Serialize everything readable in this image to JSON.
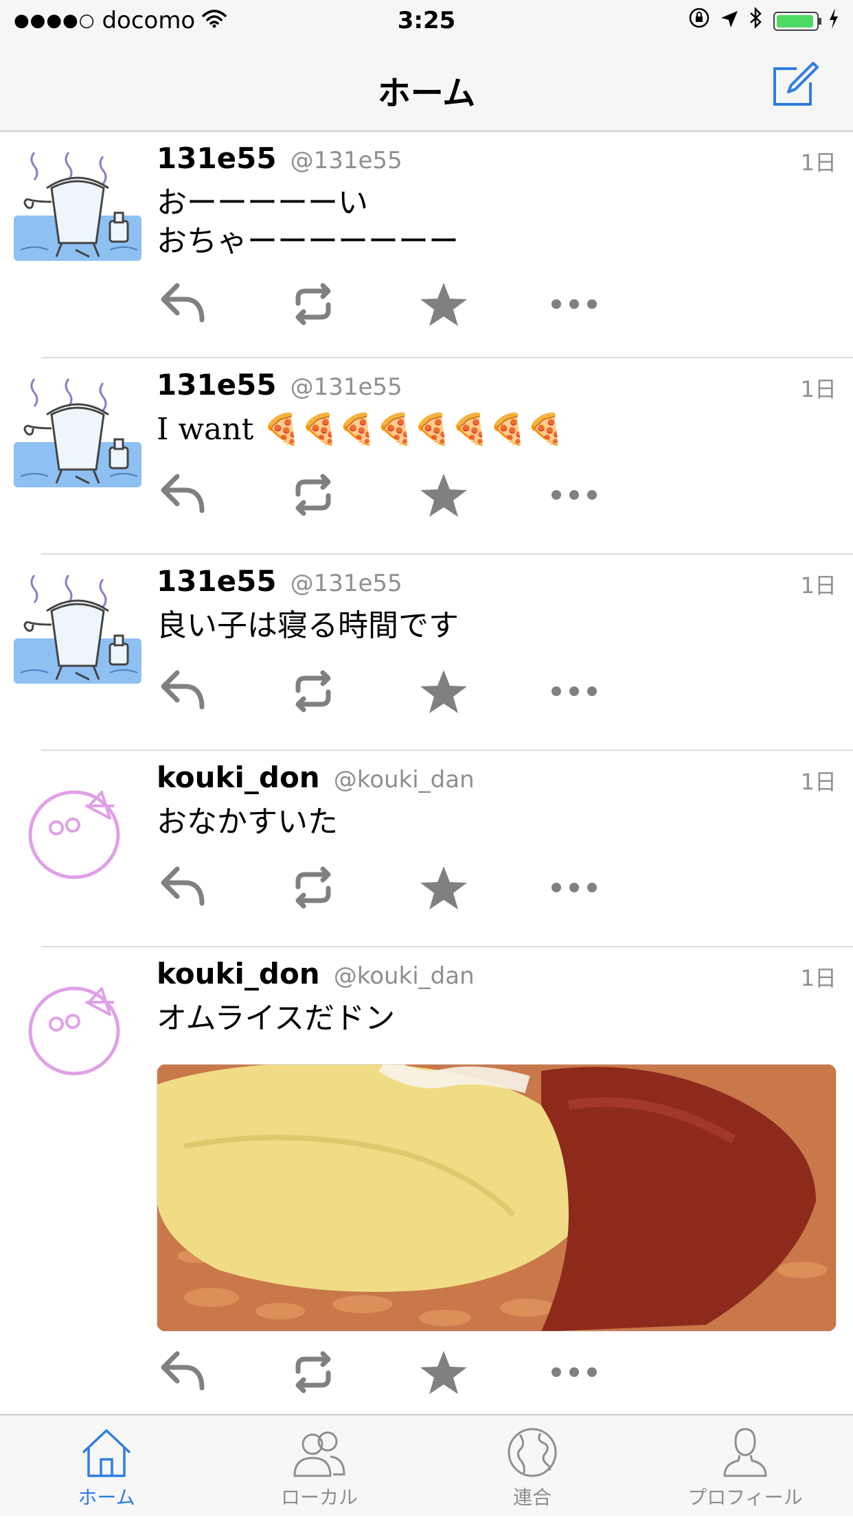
{
  "status_bar": {
    "signal": "●●●●○",
    "carrier": "docomo",
    "time": "3:25"
  },
  "nav": {
    "title": "ホーム"
  },
  "posts": [
    {
      "name": "131e55",
      "handle": "@131e55",
      "time": "1日",
      "text": "おーーーーーい\nおちゃーーーーーーー",
      "avatar": "kettle-bath-avatar"
    },
    {
      "name": "131e55",
      "handle": "@131e55",
      "time": "1日",
      "text": "I want 🍕🍕🍕🍕🍕🍕🍕🍕",
      "avatar": "kettle-bath-avatar"
    },
    {
      "name": "131e55",
      "handle": "@131e55",
      "time": "1日",
      "text": "良い子は寝る時間です",
      "avatar": "kettle-bath-avatar"
    },
    {
      "name": "kouki_don",
      "handle": "@kouki_dan",
      "time": "1日",
      "text": "おなかすいた",
      "avatar": "pink-doodle-avatar"
    },
    {
      "name": "kouki_don",
      "handle": "@kouki_dan",
      "time": "1日",
      "text": "オムライスだドン",
      "avatar": "pink-doodle-avatar",
      "has_photo": true
    }
  ],
  "tabs": [
    {
      "label": "ホーム",
      "icon": "home-icon",
      "active": true
    },
    {
      "label": "ローカル",
      "icon": "local-users-icon",
      "active": false
    },
    {
      "label": "連合",
      "icon": "globe-icon",
      "active": false
    },
    {
      "label": "プロフィール",
      "icon": "profile-icon",
      "active": false
    }
  ],
  "colors": {
    "accent": "#2f7de1",
    "action_gray": "#808080",
    "secondary_text": "#8e8e93",
    "battery_green": "#4cd964"
  }
}
